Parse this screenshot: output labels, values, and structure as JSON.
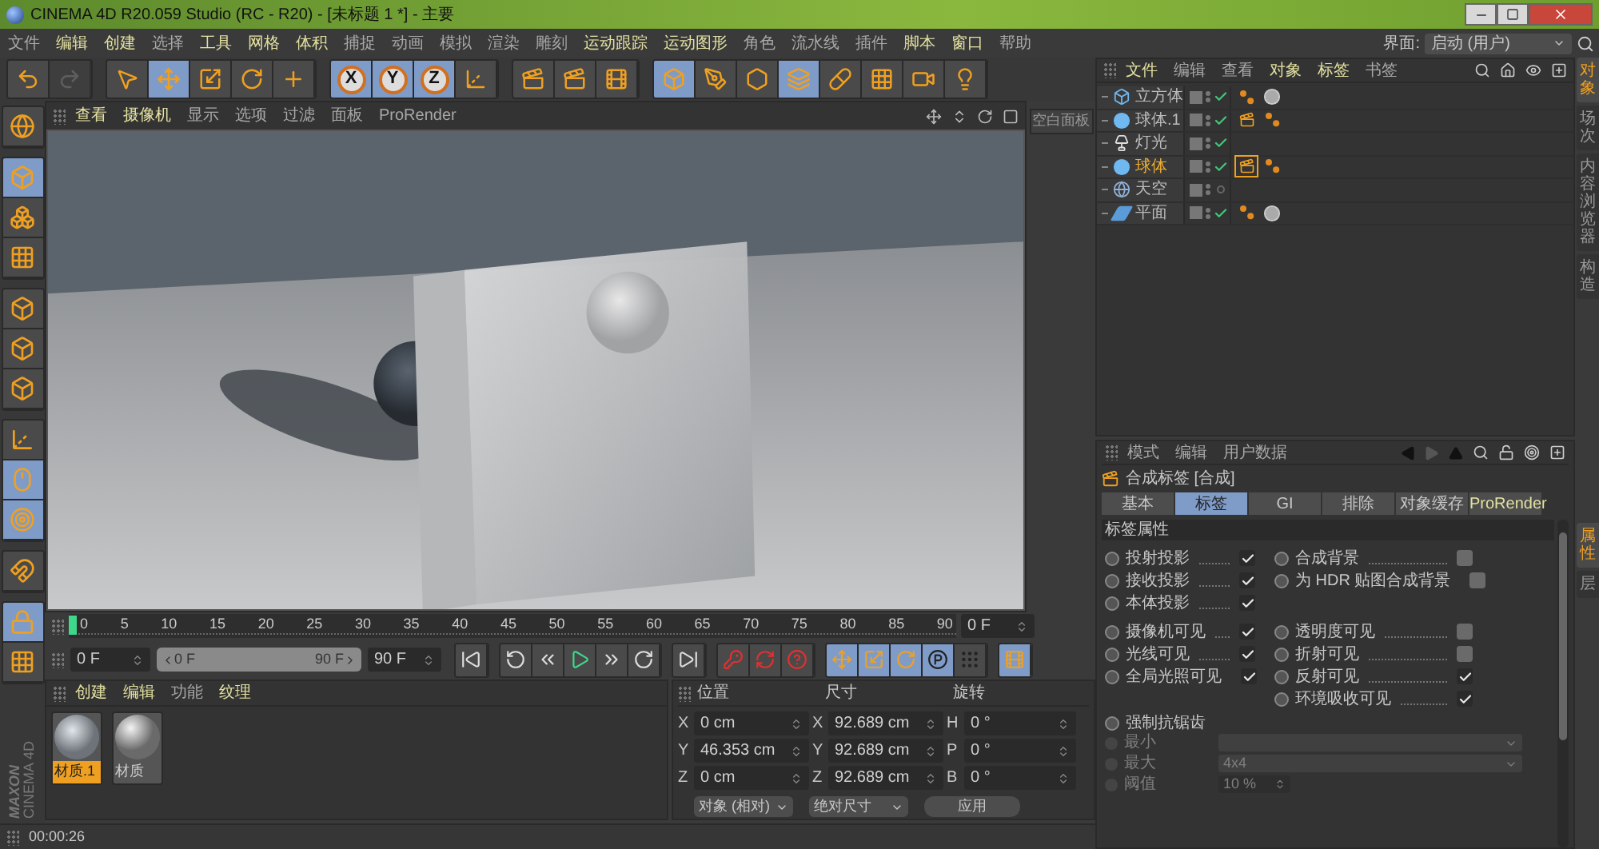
{
  "title_bar": {
    "title": "CINEMA 4D R20.059 Studio (RC - R20) - [未标题 1 *] - 主要"
  },
  "menu_bar": [
    {
      "label": "文件",
      "highlighted": false
    },
    {
      "label": "编辑",
      "highlighted": true
    },
    {
      "label": "创建",
      "highlighted": true
    },
    {
      "label": "选择",
      "highlighted": false
    },
    {
      "label": "工具",
      "highlighted": true
    },
    {
      "label": "网格",
      "highlighted": true
    },
    {
      "label": "体积",
      "highlighted": true
    },
    {
      "label": "捕捉",
      "highlighted": false
    },
    {
      "label": "动画",
      "highlighted": false
    },
    {
      "label": "模拟",
      "highlighted": false
    },
    {
      "label": "渲染",
      "highlighted": false
    },
    {
      "label": "雕刻",
      "highlighted": false
    },
    {
      "label": "运动跟踪",
      "highlighted": true
    },
    {
      "label": "运动图形",
      "highlighted": true
    },
    {
      "label": "角色",
      "highlighted": false
    },
    {
      "label": "流水线",
      "highlighted": false
    },
    {
      "label": "插件",
      "highlighted": false
    },
    {
      "label": "脚本",
      "highlighted": true
    },
    {
      "label": "窗口",
      "highlighted": true
    },
    {
      "label": "帮助",
      "highlighted": false
    }
  ],
  "layout_selector": {
    "label": "界面:",
    "value": "启动 (用户)"
  },
  "toolbar": {
    "groups": [
      {
        "buttons": [
          {
            "selected": false,
            "disabled": false
          },
          {
            "selected": false,
            "disabled": true
          }
        ]
      },
      {
        "buttons": [
          {
            "selected": false,
            "disabled": false
          },
          {
            "selected": true,
            "disabled": false
          },
          {
            "selected": false,
            "disabled": false
          },
          {
            "selected": false,
            "disabled": false
          },
          {
            "selected": false,
            "disabled": false
          }
        ]
      },
      {
        "buttons": [
          {
            "label": "X",
            "selected": true,
            "disabled": false
          },
          {
            "label": "Y",
            "selected": true,
            "disabled": false
          },
          {
            "label": "Z",
            "selected": true,
            "disabled": false
          },
          {
            "selected": false,
            "disabled": false
          }
        ]
      },
      {
        "buttons": [
          {
            "selected": false,
            "disabled": false
          },
          {
            "selected": false,
            "disabled": false
          },
          {
            "selected": false,
            "disabled": false
          }
        ]
      },
      {
        "buttons": [
          {
            "selected": true,
            "disabled": false
          },
          {
            "selected": false,
            "disabled": false
          },
          {
            "selected": false,
            "disabled": false
          },
          {
            "selected": true,
            "disabled": false
          },
          {
            "selected": false,
            "disabled": false
          },
          {
            "selected": false,
            "disabled": false
          },
          {
            "selected": false,
            "disabled": false
          },
          {
            "selected": false,
            "disabled": false
          }
        ]
      }
    ]
  },
  "left_tools": {
    "groups": [
      {
        "buttons": [
          {
            "selected": false
          }
        ]
      },
      {
        "buttons": [
          {
            "selected": true
          },
          {
            "selected": false
          },
          {
            "selected": false
          }
        ]
      },
      {
        "buttons": [
          {
            "selected": false
          },
          {
            "selected": false
          },
          {
            "selected": false
          }
        ]
      },
      {
        "buttons": [
          {
            "selected": false
          },
          {
            "selected": true
          },
          {
            "selected": true
          }
        ]
      },
      {
        "buttons": [
          {
            "selected": false
          }
        ]
      },
      {
        "buttons": [
          {
            "selected": true
          },
          {
            "selected": false
          }
        ]
      }
    ]
  },
  "logo": {
    "brand": "MAXON",
    "product": "CINEMA 4D"
  },
  "viewport": {
    "menu": [
      {
        "label": "查看",
        "highlighted": true
      },
      {
        "label": "摄像机",
        "highlighted": true
      },
      {
        "label": "显示",
        "highlighted": false
      },
      {
        "label": "选项",
        "highlighted": false
      },
      {
        "label": "过滤",
        "highlighted": false
      },
      {
        "label": "面板",
        "highlighted": false
      },
      {
        "label": "ProRender",
        "highlighted": false
      }
    ]
  },
  "blank_panel": {
    "label": "空白面板"
  },
  "timeline": {
    "ticks": [
      "0",
      "5",
      "10",
      "15",
      "20",
      "25",
      "30",
      "35",
      "40",
      "45",
      "50",
      "55",
      "60",
      "65",
      "70",
      "75",
      "80",
      "85",
      "90"
    ],
    "current_frame": "0 F"
  },
  "transport": {
    "start": "0 F",
    "range": {
      "start": "0 F",
      "end": "90 F",
      "level": 1
    },
    "end": "90 F",
    "groups": [
      {
        "buttons": [
          {
            "selected": false
          }
        ]
      },
      {
        "buttons": [
          {
            "selected": false
          },
          {
            "selected": false
          },
          {
            "selected": false
          },
          {
            "selected": false
          },
          {
            "selected": false
          }
        ]
      },
      {
        "buttons": [
          {
            "selected": false
          }
        ]
      },
      {
        "buttons": [
          {
            "selected": false
          },
          {
            "selected": false
          },
          {
            "selected": false
          }
        ]
      },
      {
        "buttons": [
          {
            "selected": true
          },
          {
            "selected": true
          },
          {
            "selected": true
          },
          {
            "selected": true
          },
          {
            "selected": false
          }
        ]
      },
      {
        "buttons": [
          {
            "selected": true
          }
        ]
      }
    ]
  },
  "materials": {
    "menu": [
      {
        "label": "创建",
        "highlighted": true
      },
      {
        "label": "编辑",
        "highlighted": true
      },
      {
        "label": "功能",
        "highlighted": false
      },
      {
        "label": "纹理",
        "highlighted": true
      }
    ],
    "items": [
      {
        "name": "材质.1",
        "kind": "glass",
        "selected": true
      },
      {
        "name": "材质",
        "kind": "matte",
        "selected": false
      }
    ]
  },
  "coordinates": {
    "headers": [
      "位置",
      "尺寸",
      "旋转"
    ],
    "rows": [
      {
        "position_axis": "X",
        "position": "0 cm",
        "size_axis": "X",
        "size": "92.689 cm",
        "rotation_axis": "H",
        "rotation": "0 °"
      },
      {
        "position_axis": "Y",
        "position": "46.353 cm",
        "size_axis": "Y",
        "size": "92.689 cm",
        "rotation_axis": "P",
        "rotation": "0 °"
      },
      {
        "position_axis": "Z",
        "position": "0 cm",
        "size_axis": "Z",
        "size": "92.689 cm",
        "rotation_axis": "B",
        "rotation": "0 °"
      }
    ],
    "position_mode": "对象 (相对)",
    "size_mode": "绝对尺寸",
    "apply": "应用"
  },
  "status_bar": {
    "time": "00:00:26"
  },
  "object_manager": {
    "menu": [
      {
        "label": "文件",
        "highlighted": true
      },
      {
        "label": "编辑",
        "highlighted": false
      },
      {
        "label": "查看",
        "highlighted": false
      },
      {
        "label": "对象",
        "highlighted": true
      },
      {
        "label": "标签",
        "highlighted": true
      },
      {
        "label": "书签",
        "highlighted": false
      }
    ],
    "objects": [
      {
        "name": "立方体",
        "kind": "cube",
        "selected": false,
        "enabled": true,
        "tags": [
          {
            "kind": "phong",
            "selected": false
          },
          {
            "kind": "material",
            "selected": false
          }
        ]
      },
      {
        "name": "球体.1",
        "kind": "sphere",
        "selected": false,
        "enabled": true,
        "tags": [
          {
            "kind": "compositing",
            "selected": false
          },
          {
            "kind": "phong",
            "selected": false
          }
        ]
      },
      {
        "name": "灯光",
        "kind": "light",
        "selected": false,
        "enabled": true
      },
      {
        "name": "球体",
        "kind": "sphere",
        "selected": true,
        "enabled": true,
        "tags": [
          {
            "kind": "compositing",
            "selected": true
          },
          {
            "kind": "phong",
            "selected": false
          }
        ]
      },
      {
        "name": "天空",
        "kind": "sky",
        "selected": false,
        "enabled": false
      },
      {
        "name": "平面",
        "kind": "plane",
        "selected": false,
        "enabled": true,
        "tags": [
          {
            "kind": "phong",
            "selected": false
          },
          {
            "kind": "material",
            "selected": false
          }
        ]
      }
    ]
  },
  "attribute_manager": {
    "menu": [
      {
        "label": "模式",
        "highlighted": false
      },
      {
        "label": "编辑",
        "highlighted": false
      },
      {
        "label": "用户数据",
        "highlighted": false
      }
    ],
    "title": "合成标签 [合成]",
    "tabs": [
      {
        "label": "基本",
        "selected": false,
        "highlighted": false
      },
      {
        "label": "标签",
        "selected": true,
        "highlighted": false
      },
      {
        "label": "GI",
        "selected": false,
        "highlighted": false
      },
      {
        "label": "排除",
        "selected": false,
        "highlighted": false
      },
      {
        "label": "对象缓存",
        "selected": false,
        "highlighted": false
      },
      {
        "label": "ProRender",
        "selected": false,
        "highlighted": true
      }
    ],
    "section": "标签属性",
    "groups": [
      {
        "left": [
          {
            "label": "投射投影",
            "checked": true,
            "animated": false
          },
          {
            "label": "接收投影",
            "checked": true,
            "animated": false
          },
          {
            "label": "本体投影",
            "checked": true,
            "animated": false
          }
        ],
        "right": [
          {
            "label": "合成背景",
            "checked": false,
            "animated": false
          },
          {
            "label": "为 HDR 贴图合成背景",
            "checked": false,
            "animated": false
          }
        ]
      },
      {
        "left": [
          {
            "label": "摄像机可见",
            "checked": true,
            "animated": false
          },
          {
            "label": "光线可见",
            "checked": true,
            "animated": false
          },
          {
            "label": "全局光照可见",
            "checked": true,
            "animated": false
          }
        ],
        "right": [
          {
            "label": "透明度可见",
            "checked": false,
            "animated": false
          },
          {
            "label": "折射可见",
            "checked": false,
            "animated": false
          },
          {
            "label": "反射可见",
            "checked": true,
            "animated": false
          },
          {
            "label": "环境吸收可见",
            "checked": true,
            "animated": false
          }
        ]
      }
    ],
    "antialiasing": {
      "label": "强制抗锯齿",
      "animated": false
    },
    "fields": [
      {
        "label": "最小",
        "kind": "dropdown",
        "disabled": true
      },
      {
        "label": "最大",
        "kind": "dropdown",
        "value": "4x4",
        "disabled": true
      },
      {
        "label": "阈值",
        "kind": "spinner",
        "value": "10 %",
        "disabled": true
      }
    ]
  },
  "side_tabs_top": [
    {
      "label": "对象",
      "selected": true
    },
    {
      "label": "场次",
      "selected": false
    },
    {
      "label": "内容浏览器",
      "selected": false
    },
    {
      "label": "构造",
      "selected": false
    }
  ],
  "side_tabs_bottom": [
    {
      "label": "属性",
      "selected": true
    },
    {
      "label": "层",
      "selected": false
    }
  ]
}
